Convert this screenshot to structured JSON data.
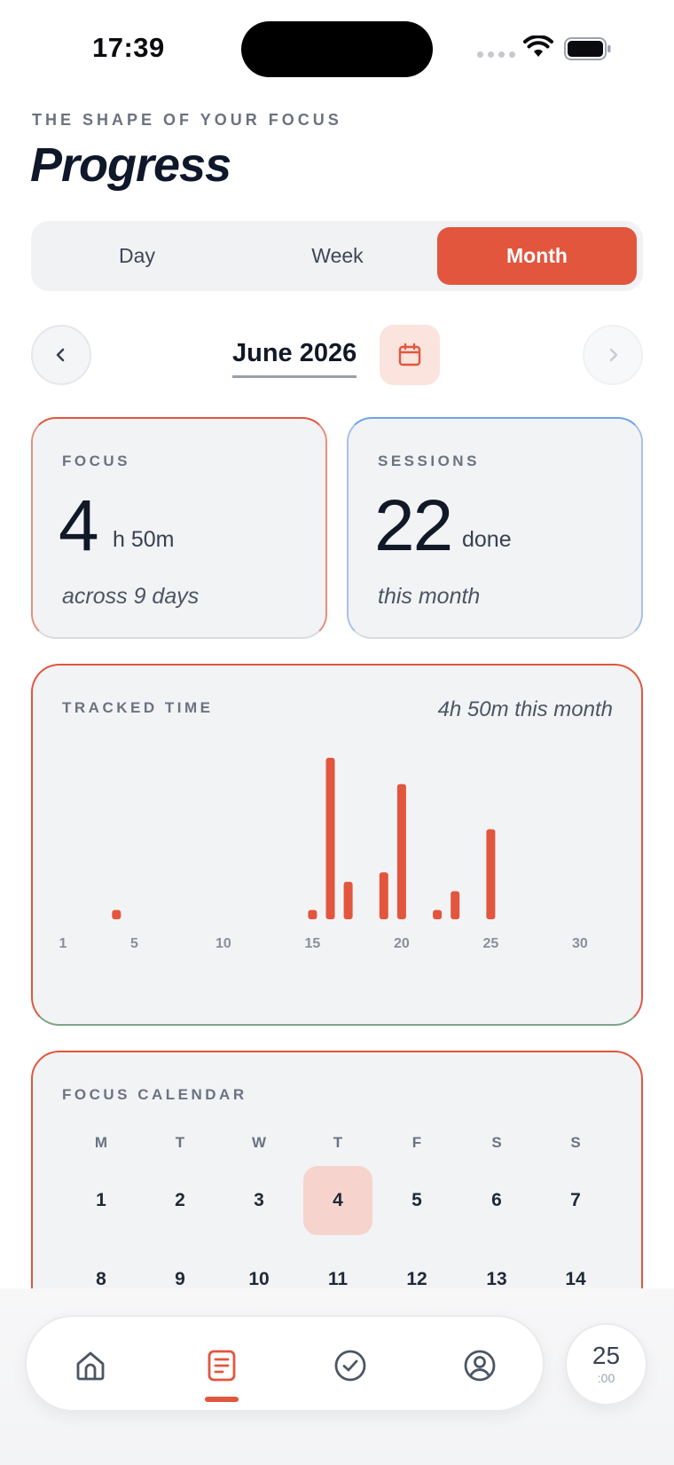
{
  "status_bar": {
    "time": "17:39"
  },
  "header": {
    "eyebrow": "THE SHAPE OF YOUR FOCUS",
    "title": "Progress"
  },
  "segmented": {
    "options": [
      "Day",
      "Week",
      "Month"
    ],
    "selected": "Month"
  },
  "month_nav": {
    "label": "June 2026"
  },
  "stats": {
    "focus": {
      "label": "FOCUS",
      "value": "4",
      "unit": "h 50m",
      "sub": "across 9 days"
    },
    "sessions": {
      "label": "SESSIONS",
      "value": "22",
      "unit": "done",
      "sub": "this month"
    }
  },
  "tracked": {
    "label": "TRACKED TIME",
    "sub": "4h 50m this month"
  },
  "chart_data": {
    "type": "bar",
    "x_ticks": [
      "1",
      "5",
      "10",
      "15",
      "20",
      "25",
      "30"
    ],
    "days": [
      4,
      15,
      16,
      17,
      19,
      20,
      22,
      23,
      25
    ],
    "minutes": [
      4,
      4,
      85,
      19,
      24,
      71,
      4,
      14,
      47
    ],
    "color": "#e2563d"
  },
  "calendar": {
    "label": "FOCUS CALENDAR",
    "weekdays": [
      "M",
      "T",
      "W",
      "T",
      "F",
      "S",
      "S"
    ],
    "weeks": [
      [
        "1",
        "2",
        "3",
        "4",
        "5",
        "6",
        "7"
      ],
      [
        "8",
        "9",
        "10",
        "11",
        "12",
        "13",
        "14"
      ]
    ],
    "today": "4"
  },
  "tabbar": {
    "items": [
      "home-icon",
      "journal-icon",
      "check-circle-icon",
      "profile-icon"
    ],
    "active": "journal-icon"
  },
  "timer": {
    "minutes": "25",
    "seconds": ":00"
  },
  "colors": {
    "accent": "#e2563d",
    "accent_soft": "#fbe3de",
    "sessions_border": "#6ea4e6"
  }
}
